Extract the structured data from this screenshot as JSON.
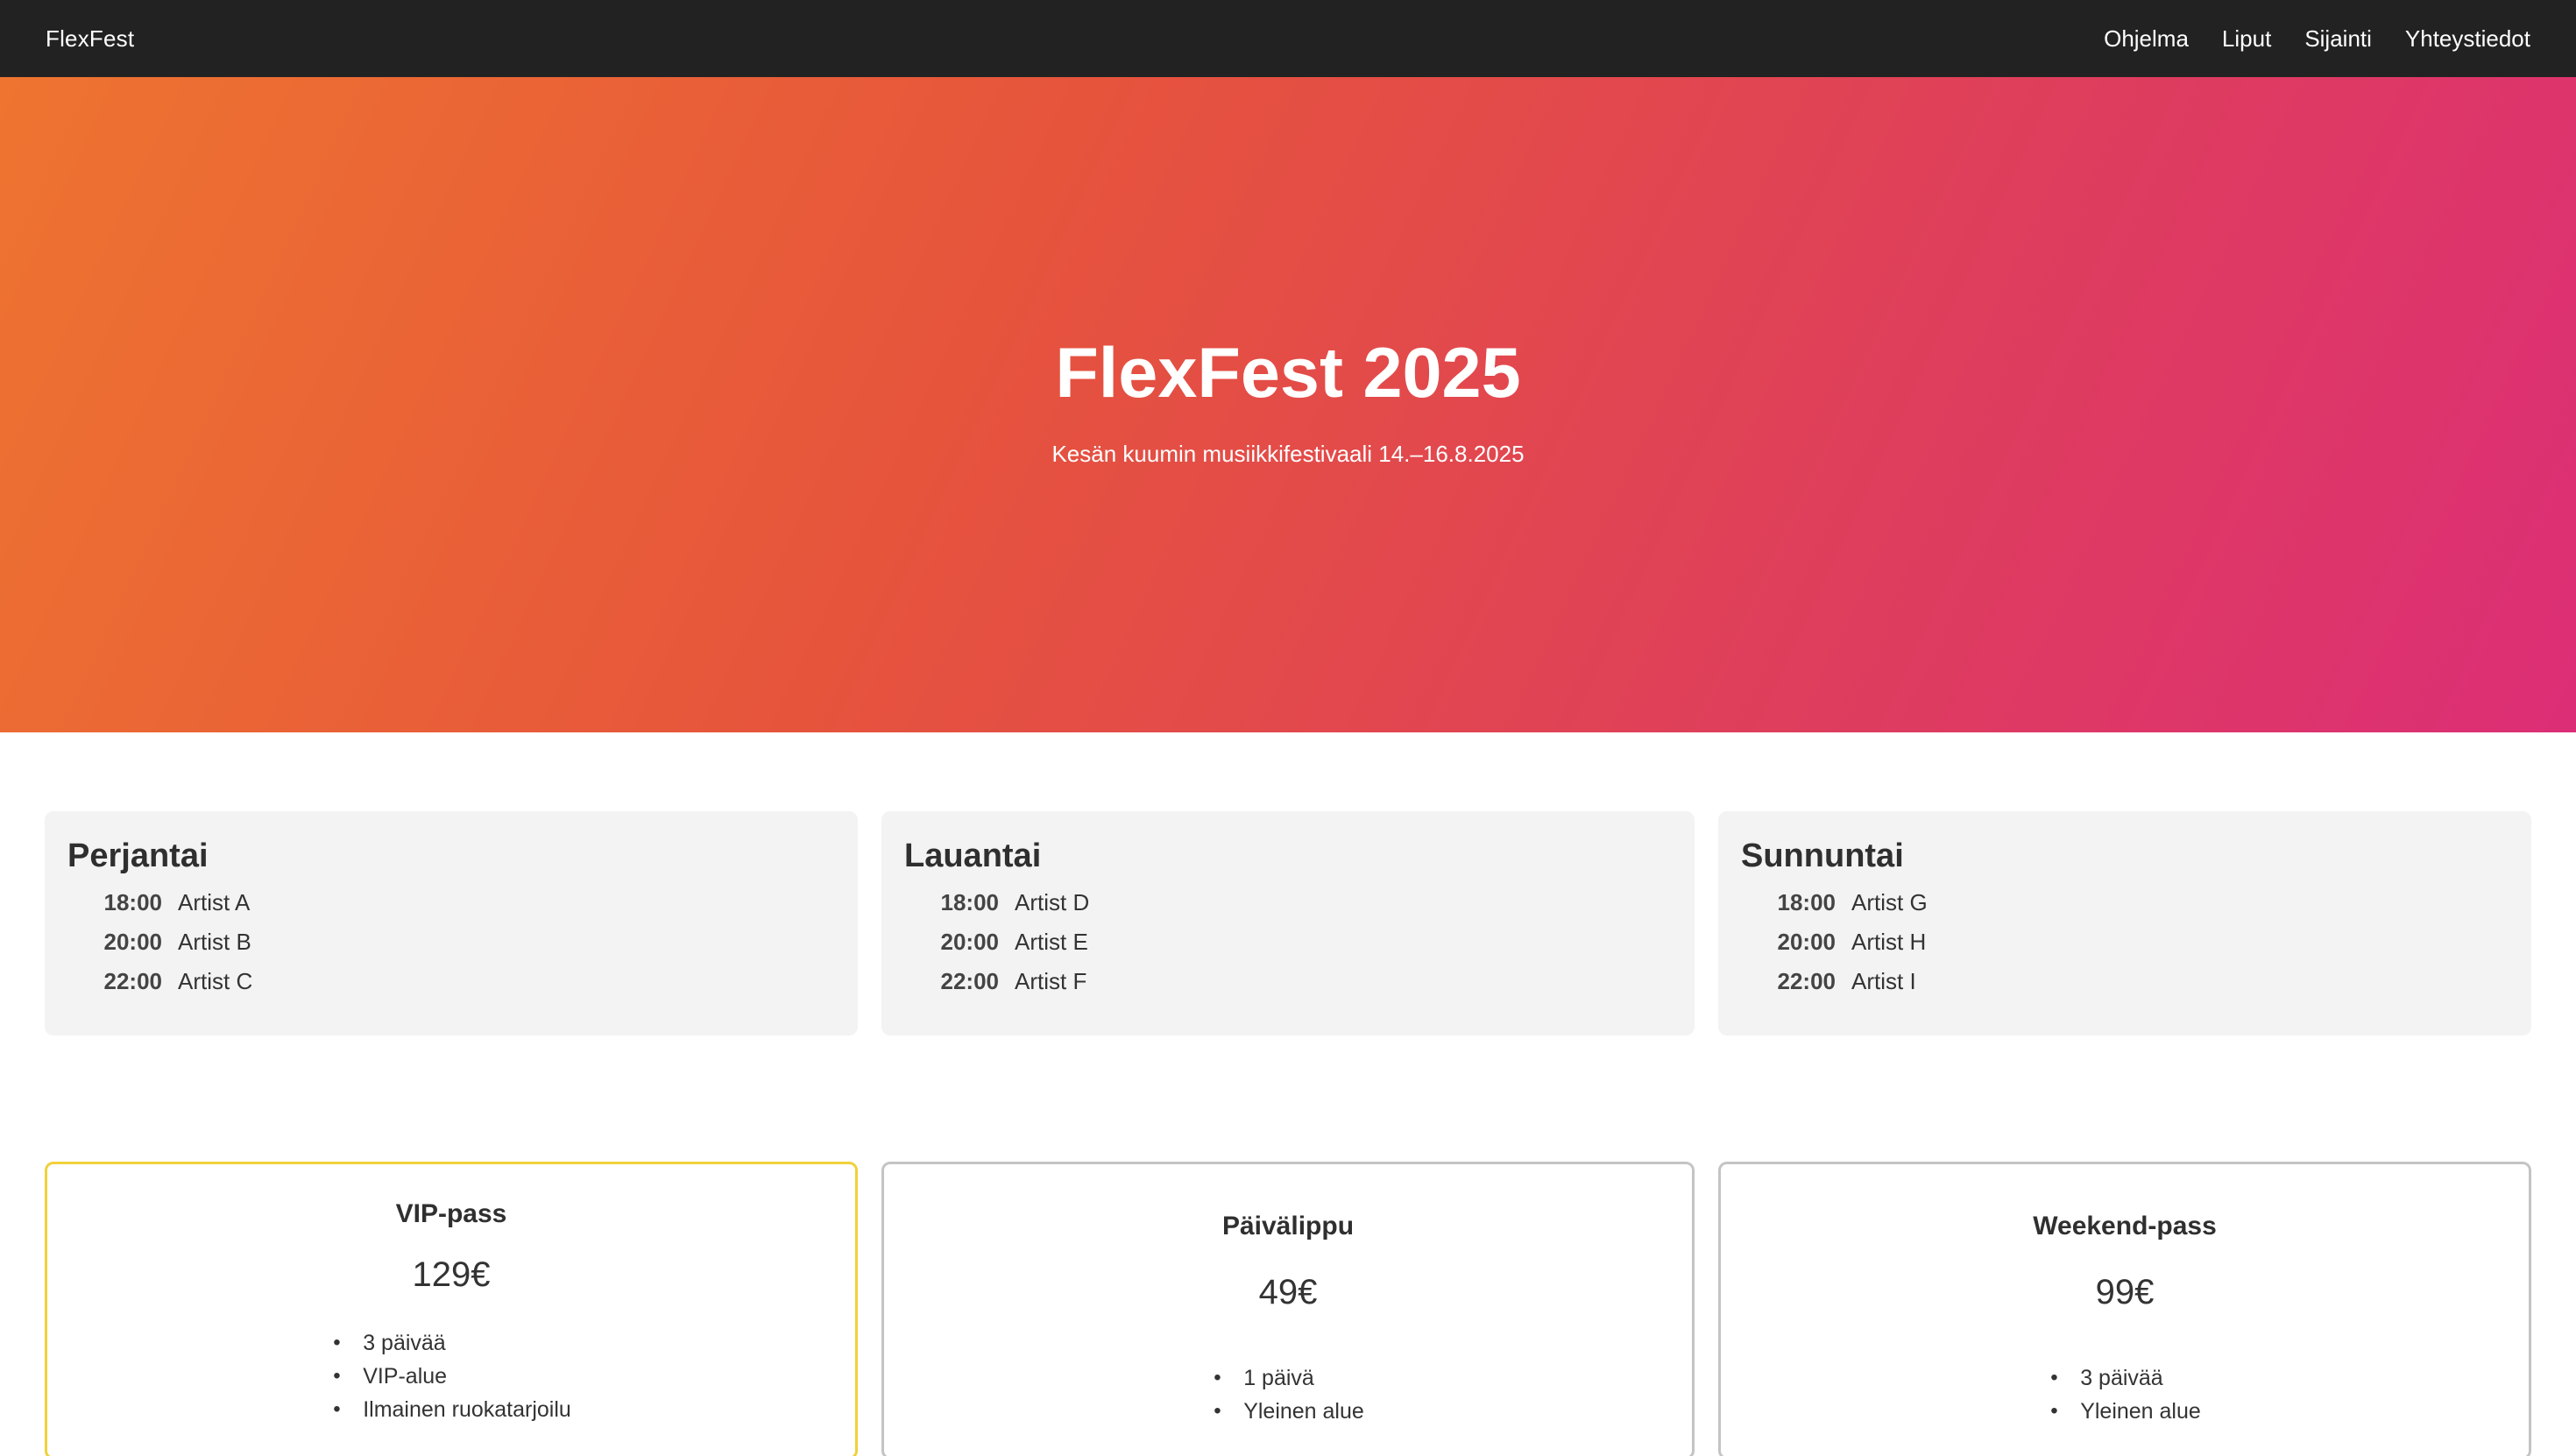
{
  "nav": {
    "brand": "FlexFest",
    "links": [
      "Ohjelma",
      "Liput",
      "Sijainti",
      "Yhteystiedot"
    ]
  },
  "hero": {
    "title": "FlexFest 2025",
    "subtitle": "Kesän kuumin musiikkifestivaali 14.–16.8.2025"
  },
  "schedule": [
    {
      "day": "Perjantai",
      "slots": [
        {
          "time": "18:00",
          "artist": "Artist A"
        },
        {
          "time": "20:00",
          "artist": "Artist B"
        },
        {
          "time": "22:00",
          "artist": "Artist C"
        }
      ]
    },
    {
      "day": "Lauantai",
      "slots": [
        {
          "time": "18:00",
          "artist": "Artist D"
        },
        {
          "time": "20:00",
          "artist": "Artist E"
        },
        {
          "time": "22:00",
          "artist": "Artist F"
        }
      ]
    },
    {
      "day": "Sunnuntai",
      "slots": [
        {
          "time": "18:00",
          "artist": "Artist G"
        },
        {
          "time": "20:00",
          "artist": "Artist H"
        },
        {
          "time": "22:00",
          "artist": "Artist I"
        }
      ]
    }
  ],
  "tickets": [
    {
      "name": "VIP-pass",
      "price": "129€",
      "features": [
        "3 päivää",
        "VIP-alue",
        "Ilmainen ruokatarjoilu"
      ],
      "highlight_color": "#f0d13a"
    },
    {
      "name": "Päivälippu",
      "price": "49€",
      "features": [
        "1 päivä",
        "Yleinen alue"
      ]
    },
    {
      "name": "Weekend-pass",
      "price": "99€",
      "features": [
        "3 päivää",
        "Yleinen alue"
      ]
    }
  ],
  "colors": {
    "navbar": "#222222",
    "hero_gradient_start": "#ee7430",
    "hero_gradient_end": "#dc2e76",
    "card_background": "#f3f3f3",
    "ticket_border": "#c4c4c4"
  }
}
